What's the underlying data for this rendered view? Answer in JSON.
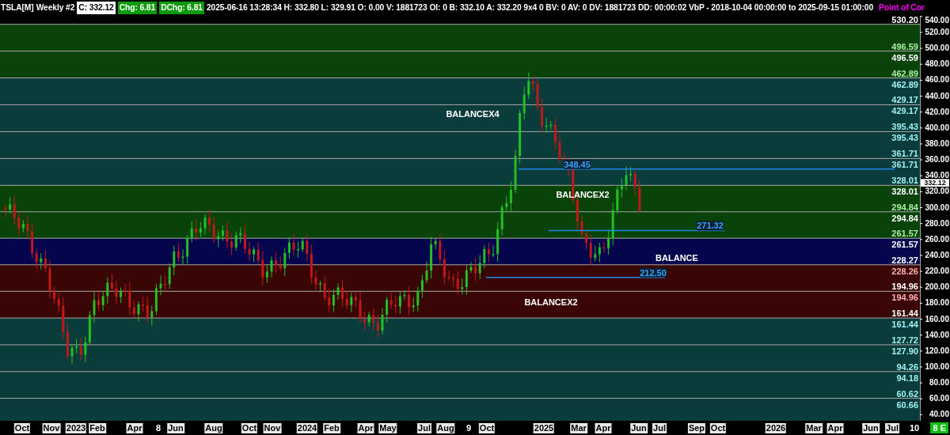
{
  "header": [
    {
      "kind": "plain",
      "text": "TSLA[M]"
    },
    {
      "kind": "plain",
      "text": "Weekly #2"
    },
    {
      "kind": "white_box",
      "text": "C: 332.12"
    },
    {
      "kind": "green_box",
      "text": "Chg: 6.81"
    },
    {
      "kind": "green_box",
      "text": "DChg: 6.81"
    },
    {
      "kind": "plain",
      "text": "2025-06-16 13:28:34 H: 332.80 L: 329.91 O: 0.00 V: 1881723 OI: 0 B: 332.10 A: 332.20 9x4 0 BV: 0 AV: 0 DV: 1881723 DD: 00:00:02 VbP - 2018-10-04  00:00:00 to 2025-09-15  01:00:00"
    },
    {
      "kind": "magenta",
      "text": "Point of Cor"
    }
  ],
  "bands": [
    {
      "bottom_label": "530.20"
    },
    {
      "color": "#0a430a",
      "bottom_label": "496.59"
    },
    {
      "color": "#0a430a",
      "top_label": "496.59",
      "bottom_label": "462.89"
    },
    {
      "color": "#0b3c3c",
      "top_label": "462.89",
      "bottom_label": "429.17"
    },
    {
      "color": "#0b3c3c",
      "top_label": "429.17",
      "bottom_label": "395.43"
    },
    {
      "color": "#0b3c3c",
      "top_label": "395.43",
      "bottom_label": "361.71"
    },
    {
      "color": "#0b3c3c",
      "top_label": "361.71",
      "bottom_label": "328.01"
    },
    {
      "color": "#0a430a",
      "top_label": "328.01",
      "bottom_label": "294.84"
    },
    {
      "color": "#0a430a",
      "top_label": "294.84",
      "bottom_label": "261.57"
    },
    {
      "color": "#05054e",
      "top_label": "261.57",
      "bottom_label": "228.27"
    },
    {
      "color": "#3a0505",
      "top_label": "228.26",
      "bottom_label": "194.96"
    },
    {
      "color": "#3a0505",
      "top_label": "194.96",
      "bottom_label": "161.44"
    },
    {
      "color": "#0b3c3c",
      "top_label": "161.44",
      "bottom_label": "127.72"
    },
    {
      "color": "#0b3c3c",
      "top_label": "127.90",
      "bottom_label": "94.26"
    },
    {
      "color": "#0b3c3c",
      "top_label": "94.18",
      "bottom_label": "60.62"
    },
    {
      "color": "#0b3c3c",
      "top_label": "60.66"
    }
  ],
  "zone_labels": [
    "BALANCEX4",
    "BALANCEX2",
    "BALANCE",
    "BALANCEX2"
  ],
  "levels": [
    "348.45",
    "271.32",
    "212.50"
  ],
  "price_axis": {
    "ticks": [
      "540.00",
      "520.00",
      "500.00",
      "480.00",
      "460.00",
      "440.00",
      "420.00",
      "400.00",
      "380.00",
      "360.00",
      "340.00",
      "320.00",
      "300.00",
      "280.00",
      "260.00",
      "240.00",
      "220.00",
      "200.00",
      "180.00",
      "160.00",
      "140.00",
      "120.00",
      "100.00",
      "80.00",
      "60.00",
      "40.00"
    ],
    "current": "332.12"
  },
  "time_axis": [
    {
      "kind": "month",
      "text": "Oct"
    },
    {
      "kind": "month",
      "text": "Nov"
    },
    {
      "kind": "year",
      "text": "2023"
    },
    {
      "kind": "month",
      "text": "Feb"
    },
    {
      "kind": "month",
      "text": "Apr"
    },
    {
      "kind": "number",
      "text": "8"
    },
    {
      "kind": "month",
      "text": "Jun"
    },
    {
      "kind": "month",
      "text": "Aug"
    },
    {
      "kind": "month",
      "text": "Oct"
    },
    {
      "kind": "month",
      "text": "Nov"
    },
    {
      "kind": "year",
      "text": "2024"
    },
    {
      "kind": "month",
      "text": "Feb"
    },
    {
      "kind": "month",
      "text": "Apr"
    },
    {
      "kind": "month",
      "text": "May"
    },
    {
      "kind": "month",
      "text": "Jul"
    },
    {
      "kind": "month",
      "text": "Aug"
    },
    {
      "kind": "number",
      "text": "9"
    },
    {
      "kind": "month",
      "text": "Oct"
    },
    {
      "kind": "year",
      "text": "2025"
    },
    {
      "kind": "month",
      "text": "Mar"
    },
    {
      "kind": "month",
      "text": "Apr"
    },
    {
      "kind": "month",
      "text": "Jun"
    },
    {
      "kind": "month",
      "text": "Jul"
    },
    {
      "kind": "month",
      "text": "Sep"
    },
    {
      "kind": "month",
      "text": "Oct"
    },
    {
      "kind": "year",
      "text": "2026"
    },
    {
      "kind": "month",
      "text": "Mar"
    },
    {
      "kind": "month",
      "text": "Apr"
    },
    {
      "kind": "month",
      "text": "Jun"
    },
    {
      "kind": "month",
      "text": "Jul"
    },
    {
      "kind": "number",
      "text": "10"
    }
  ],
  "status_badge": "8 E"
}
